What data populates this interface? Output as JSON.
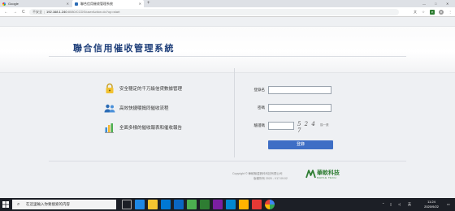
{
  "browser": {
    "tabs": [
      {
        "title": "Google"
      },
      {
        "title": "聯合信用催收管理系統"
      }
    ],
    "new_tab": "+",
    "window_controls": {
      "minimize": "—",
      "maximize": "□",
      "close": "✕"
    },
    "nav": {
      "back": "←",
      "forward": "→",
      "reload": "C"
    },
    "address": {
      "security": "不安全",
      "host": "192.168.1.240",
      "path": ":8080/CCDS/userAction.do?op=start"
    }
  },
  "page": {
    "title": "聯合信用催收管理系統",
    "features": [
      {
        "icon": "lock-icon",
        "text": "安全穩定的千万級信貸數據管理"
      },
      {
        "icon": "users-icon",
        "text": "高效快捷嗄搗同催收流程"
      },
      {
        "icon": "bar-chart-icon",
        "text": "全面多樣的催收報表和催收報告"
      }
    ],
    "form": {
      "username_label": "登錄名",
      "username_value": "",
      "password_label": "密碼",
      "password_value": "",
      "captcha_label": "驗證碼",
      "captcha_value": "",
      "captcha_image_text": "5 2 4 7",
      "captcha_refresh_hint": "換一張",
      "login_button": "登錄"
    },
    "footer": {
      "copyright": "Copyright ©  華軟聯遠數科科技有限公司",
      "version": "版權所有 2020 - V17.09.02",
      "logo_text": "華軟科技",
      "logo_sub": "MAPLE TECH"
    }
  },
  "taskbar": {
    "search_placeholder": "在這里輸入你要搜索的内容",
    "tray_lang": "英",
    "time": "11:24",
    "date": "2020/9/22",
    "colors": {
      "accent": "#3e6ec5",
      "title": "#1f3f7a",
      "logo": "#2e7d32"
    }
  }
}
